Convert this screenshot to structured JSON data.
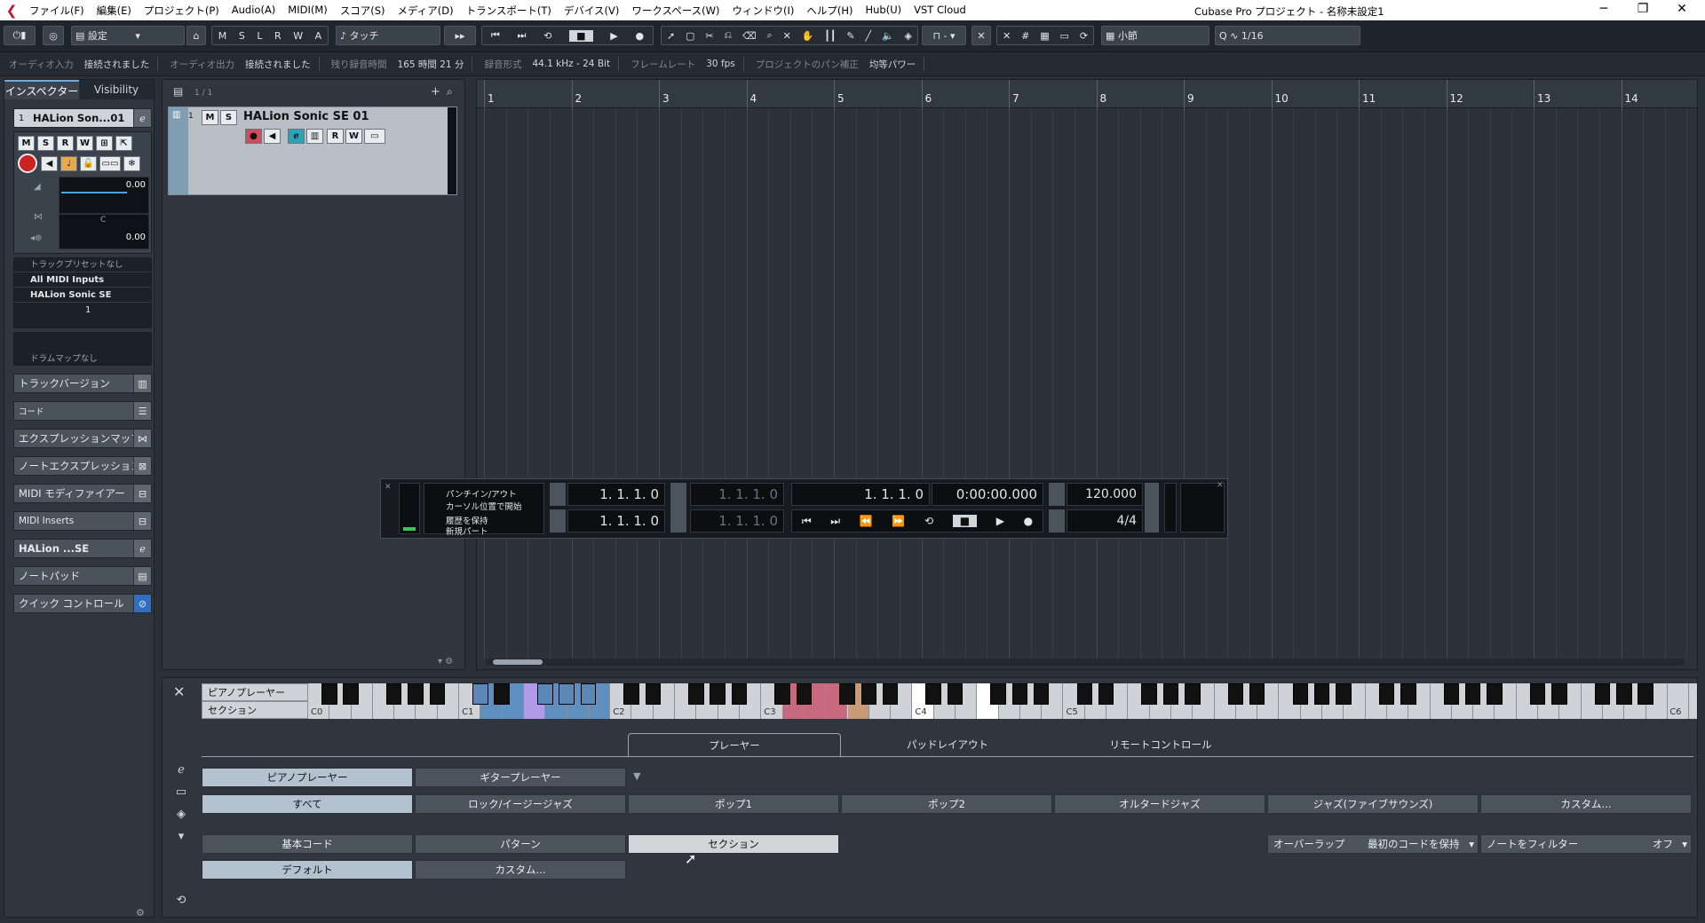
{
  "app": {
    "title": "Cubase Pro プロジェクト - 名称未設定1"
  },
  "menu": [
    "ファイル(F)",
    "編集(E)",
    "プロジェクト(P)",
    "Audio(A)",
    "MIDI(M)",
    "スコア(S)",
    "メディア(D)",
    "トランスポート(T)",
    "デバイス(V)",
    "ワークスペース(W)",
    "ウィンドウ(I)",
    "ヘルプ(H)",
    "Hub(U)",
    "VST Cloud"
  ],
  "toolbar": {
    "settings": "設定",
    "mode_letters": [
      "M",
      "S",
      "L",
      "R",
      "W",
      "A"
    ],
    "automation_mode": "タッチ",
    "snap_type": "小節",
    "quantize": "1/16"
  },
  "status": [
    {
      "label": "オーディオ入力",
      "value": "接続されました"
    },
    {
      "label": "オーディオ出力",
      "value": "接続されました"
    },
    {
      "label": "残り録音時間",
      "value": "165 時間 21 分"
    },
    {
      "label": "録音形式",
      "value": "44.1 kHz - 24 Bit"
    },
    {
      "label": "フレームレート",
      "value": "30 fps"
    },
    {
      "label": "プロジェクトのパン補正",
      "value": "均等パワー"
    }
  ],
  "inspector": {
    "tabs": [
      "インスペクター",
      "Visibility"
    ],
    "track_name": "HALion Son...01",
    "track_number": "1",
    "buttons": [
      "M",
      "S",
      "R",
      "W"
    ],
    "volume": "0.00",
    "pan_center": "C",
    "pan": "0.00",
    "preset": "トラックプリセットなし",
    "input": "All MIDI Inputs",
    "output": "HALion Sonic SE",
    "channel": "1",
    "drum_map": "ドラムマップなし",
    "sections": [
      "トラックバージョン",
      "コード",
      "エクスプレッションマップ",
      "ノートエクスプレッション",
      "MIDI モディファイアー",
      "MIDI Inserts",
      "HALion ...SE",
      "ノートパッド",
      "クイック コントロール"
    ]
  },
  "tracklist": {
    "count": "1 / 1",
    "track_index": "1",
    "track_name": "HALion Sonic SE 01",
    "buttons": [
      "M",
      "S",
      "R",
      "W"
    ]
  },
  "ruler": {
    "bars": [
      "1",
      "2",
      "3",
      "4",
      "5",
      "6",
      "7",
      "8",
      "9",
      "10",
      "11",
      "12",
      "13",
      "14"
    ]
  },
  "transport": {
    "punch": "パンチイン/アウト",
    "cursor_start": "カーソル位置で開始",
    "keep_history": "履歴を保持",
    "new_part": "新規パート",
    "left_locator": "1. 1. 1.  0",
    "right_locator": "1. 1. 1.  0",
    "sub_pos1": "1. 1. 1.  0",
    "sub_pos2": "1. 1. 1.  0",
    "position": "1. 1. 1.  0",
    "time": "0:00:00.000",
    "tempo": "120.000",
    "signature": "4/4"
  },
  "chord_pads": {
    "selector1": "ピアノプレーヤー",
    "selector2": "セクション",
    "key_labels": [
      "C0",
      "C1",
      "C2",
      "C3",
      "C4",
      "C5",
      "C6"
    ],
    "tabs": [
      "プレーヤー",
      "パッドレイアウト",
      "リモートコントロール"
    ],
    "players": [
      "ピアノプレーヤー",
      "ギタープレーヤー"
    ],
    "styles": [
      "すべて",
      "ロック/イージージャズ",
      "ポップ1",
      "ポップ2",
      "オルタードジャズ",
      "ジャズ(ファイブサウンズ)",
      "カスタム..."
    ],
    "modes": [
      "基本コード",
      "パターン",
      "セクション"
    ],
    "modes2": [
      "デフォルト",
      "カスタム..."
    ],
    "overlap_label": "オーバーラップ",
    "overlap_value": "最初のコードを保持",
    "filter_label": "ノートをフィルター",
    "filter_value": "オフ"
  }
}
